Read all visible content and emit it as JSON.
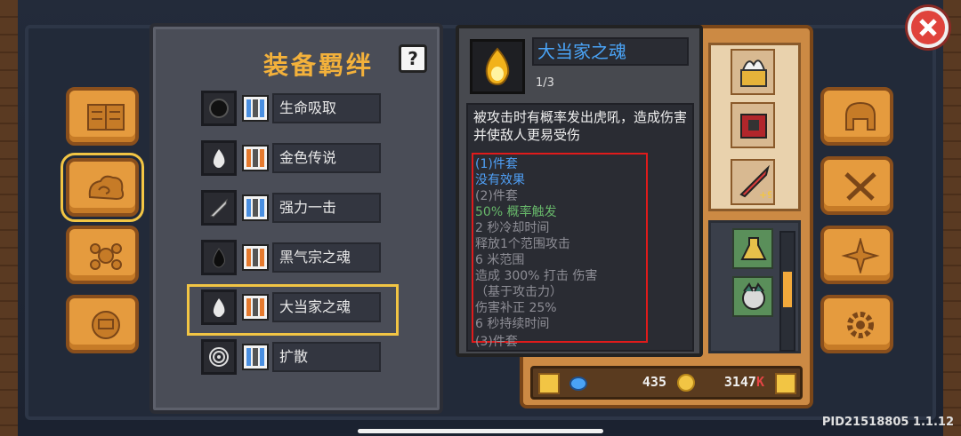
{
  "panel": {
    "title": "装备羁绊",
    "help_label": "?"
  },
  "bonds": [
    {
      "name": "生命吸取",
      "icon": "dark-orb-icon",
      "bar_color": "blue"
    },
    {
      "name": "金色传说",
      "icon": "white-flame-icon",
      "bar_color": "orange"
    },
    {
      "name": "强力一击",
      "icon": "sword-icon",
      "bar_color": "blue"
    },
    {
      "name": "黑气宗之魂",
      "icon": "black-flame-icon",
      "bar_color": "orange"
    },
    {
      "name": "大当家之魂",
      "icon": "white-flame-icon",
      "bar_color": "orange",
      "selected": true
    },
    {
      "name": "扩散",
      "icon": "ripple-icon",
      "bar_color": "blue"
    }
  ],
  "popup": {
    "title": "大当家之魂",
    "count": "1/3",
    "description": "被攻击时有概率发出虎吼，造成伤害并使敌人更易受伤",
    "effects": [
      {
        "text": "(1)件套",
        "color": "blue"
      },
      {
        "text": "没有效果",
        "color": "blue"
      },
      {
        "text": "(2)件套",
        "color": "gray"
      },
      {
        "text": "50% 概率触发",
        "color": "green"
      },
      {
        "text": "2 秒冷却时间",
        "color": "gray"
      },
      {
        "text": "释放1个范围攻击",
        "color": "gray"
      },
      {
        "text": "6 米范围",
        "color": "gray"
      },
      {
        "text": "造成 300% 打击 伤害",
        "color": "gray"
      },
      {
        "text": "（基于攻击力）",
        "color": "gray"
      },
      {
        "text": "伤害补正 25%",
        "color": "gray"
      },
      {
        "text": "6 秒持续时间",
        "color": "gray"
      },
      {
        "text": "(3)件套",
        "color": "gray"
      }
    ]
  },
  "resources": {
    "gems": "435",
    "coins": "3147",
    "coins_suffix": "K"
  },
  "version": "PID21518805 1.1.12",
  "colors": {
    "accent": "#f3b13b",
    "selection": "#f2c544",
    "highlight_box": "#e01b1b",
    "title_blue": "#4aa3f5"
  }
}
